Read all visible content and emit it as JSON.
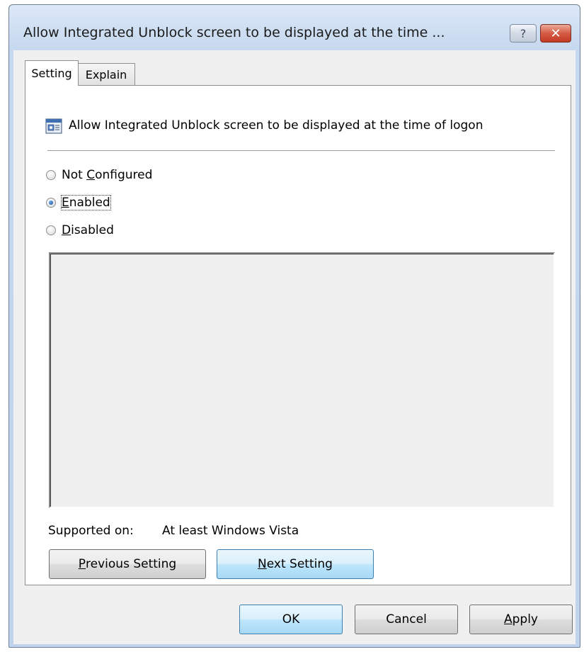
{
  "window": {
    "title": "Allow Integrated Unblock screen to be displayed at the time ...",
    "help_label": "?",
    "close_label": "✕"
  },
  "tabs": [
    {
      "label": "Setting",
      "active": true
    },
    {
      "label": "Explain",
      "active": false
    }
  ],
  "policy": {
    "title": "Allow Integrated Unblock screen to be displayed at the time of logon",
    "icon": "policy-setting-icon"
  },
  "options": {
    "selected": "Enabled",
    "not_configured": {
      "pre": "Not ",
      "accel": "C",
      "post": "onfigured"
    },
    "enabled": {
      "pre": "",
      "accel": "E",
      "post": "nabled"
    },
    "disabled": {
      "pre": "",
      "accel": "D",
      "post": "isabled"
    }
  },
  "supported": {
    "label": "Supported on:",
    "value": "At least Windows Vista"
  },
  "nav_buttons": {
    "previous": {
      "accel": "P",
      "rest": "revious Setting"
    },
    "next": {
      "accel": "N",
      "rest": "ext Setting"
    }
  },
  "dialog_buttons": {
    "ok": "OK",
    "cancel": "Cancel",
    "apply": {
      "accel": "A",
      "rest": "pply"
    }
  },
  "colors": {
    "title_bar": "#c7d9ef",
    "close_button": "#d65b45",
    "default_button": "#bee6fd",
    "panel_bg": "#f0f0f0"
  }
}
